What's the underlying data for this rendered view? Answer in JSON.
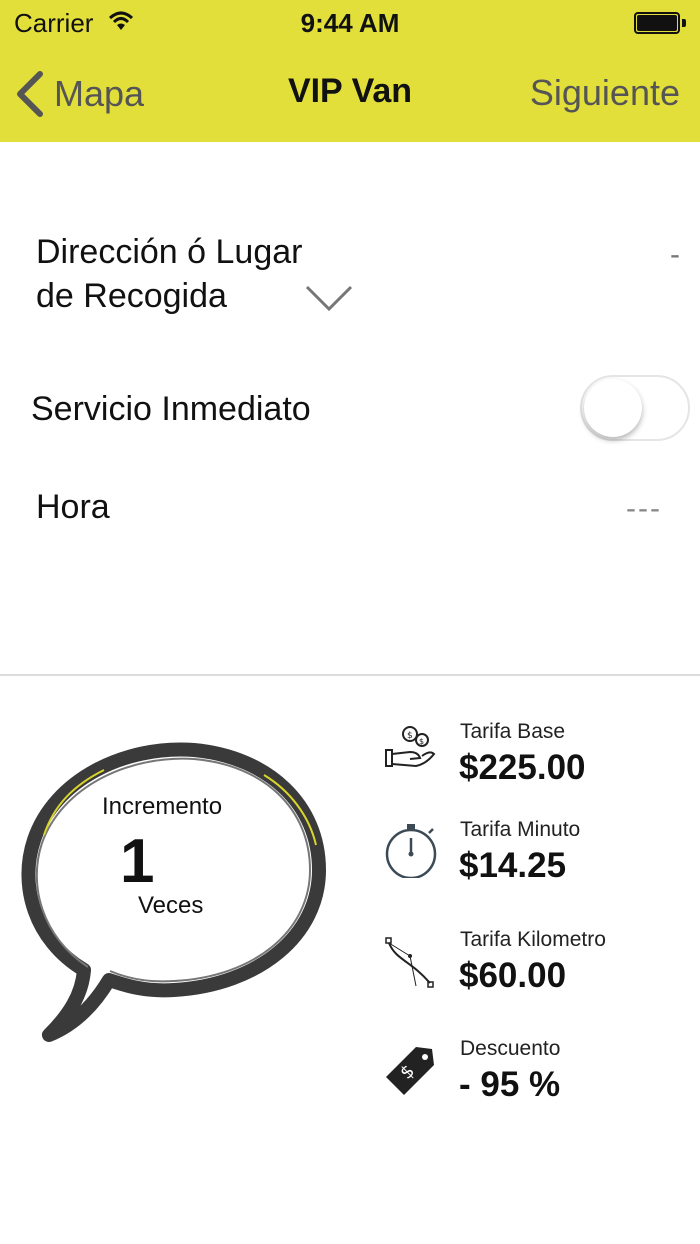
{
  "status_bar": {
    "carrier": "Carrier",
    "time": "9:44 AM"
  },
  "nav": {
    "back_label": "Mapa",
    "title": "VIP Van",
    "next_label": "Siguiente"
  },
  "form": {
    "pickup_label_line1": "Dirección ó Lugar",
    "pickup_label_line2": "de Recogida",
    "pickup_value": "-",
    "service_label": "Servicio Inmediato",
    "service_on": false,
    "hour_label": "Hora",
    "hour_value": "---"
  },
  "increment": {
    "label": "Incremento",
    "value": "1",
    "unit": "Veces"
  },
  "fees": [
    {
      "icon": "hand-coins-icon",
      "label": "Tarifa Base",
      "value": "$225.00"
    },
    {
      "icon": "stopwatch-icon",
      "label": "Tarifa Minuto",
      "value": "$14.25"
    },
    {
      "icon": "route-curve-icon",
      "label": "Tarifa Kilometro",
      "value": "$60.00"
    },
    {
      "icon": "price-tag-icon",
      "label": "Descuento",
      "value": "- 95 %"
    }
  ],
  "colors": {
    "header": "#e2df3a",
    "text": "#111111",
    "muted": "#555555"
  }
}
